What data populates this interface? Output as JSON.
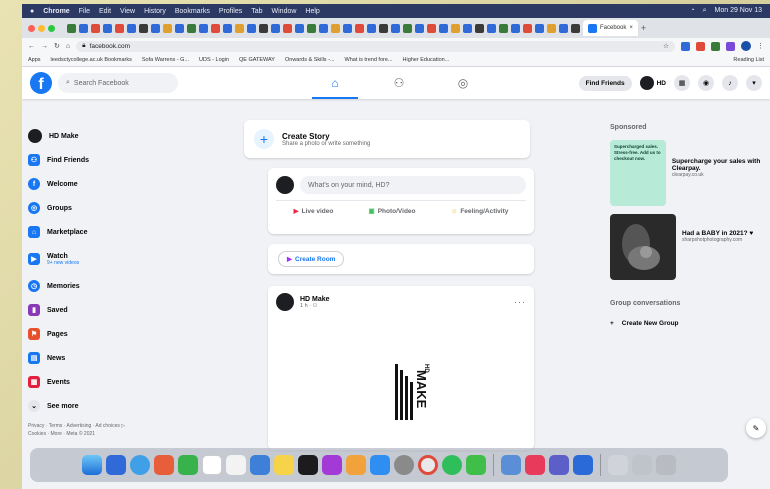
{
  "menubar": {
    "items": [
      "Chrome",
      "File",
      "Edit",
      "View",
      "History",
      "Bookmarks",
      "Profiles",
      "Tab",
      "Window",
      "Help"
    ],
    "clock": "Mon 29 Nov 13"
  },
  "browser": {
    "active_tab": "Facebook",
    "url": "facebook.com",
    "bookmarks": [
      "Apps",
      "leedsctycollege.ac.uk Bookmarks",
      "Sofa Warrens - G...",
      "UDS - Login",
      "QE GATEWAY",
      "Onwards & Skills -...",
      "What is trend fore...",
      "Higher Education...",
      "Reading List"
    ]
  },
  "header": {
    "search_placeholder": "Search Facebook",
    "find_friends": "Find Friends",
    "user_short": "HD"
  },
  "sidebar": {
    "items": [
      {
        "label": "HD Make"
      },
      {
        "label": "Find Friends"
      },
      {
        "label": "Welcome"
      },
      {
        "label": "Groups"
      },
      {
        "label": "Marketplace"
      },
      {
        "label": "Watch",
        "sub": "9+ new videos"
      },
      {
        "label": "Memories"
      },
      {
        "label": "Saved"
      },
      {
        "label": "Pages"
      },
      {
        "label": "News"
      },
      {
        "label": "Events"
      },
      {
        "label": "See more"
      }
    ],
    "footer_line1": "Privacy · Terms · Advertising · Ad choices ▷",
    "footer_line2": "Cookies · More · Meta © 2021"
  },
  "story": {
    "title": "Create Story",
    "subtitle": "Share a photo or write something"
  },
  "composer": {
    "placeholder": "What's on your mind, HD?",
    "live": "Live video",
    "photo": "Photo/Video",
    "feeling": "Feeling/Activity"
  },
  "room": {
    "label": "Create Room"
  },
  "post": {
    "author": "HD Make",
    "time": "1 h · ⚇",
    "logo_small": "HD",
    "logo_big": "MAKE"
  },
  "right": {
    "sponsored_title": "Sponsored",
    "ads": [
      {
        "headline": "Supercharge your sales with Clearpay.",
        "domain": "clearpay.co.uk",
        "image_text": "Supercharged sales. Stress-free. Add us to checkout now."
      },
      {
        "headline": "Had a BABY in 2021? ♥",
        "domain": "sharpshotphotography.com"
      }
    ],
    "groups_title": "Group conversations",
    "new_group": "Create New Group"
  },
  "colors": {
    "fb_blue": "#1877f2",
    "background": "#f0f2f5"
  }
}
